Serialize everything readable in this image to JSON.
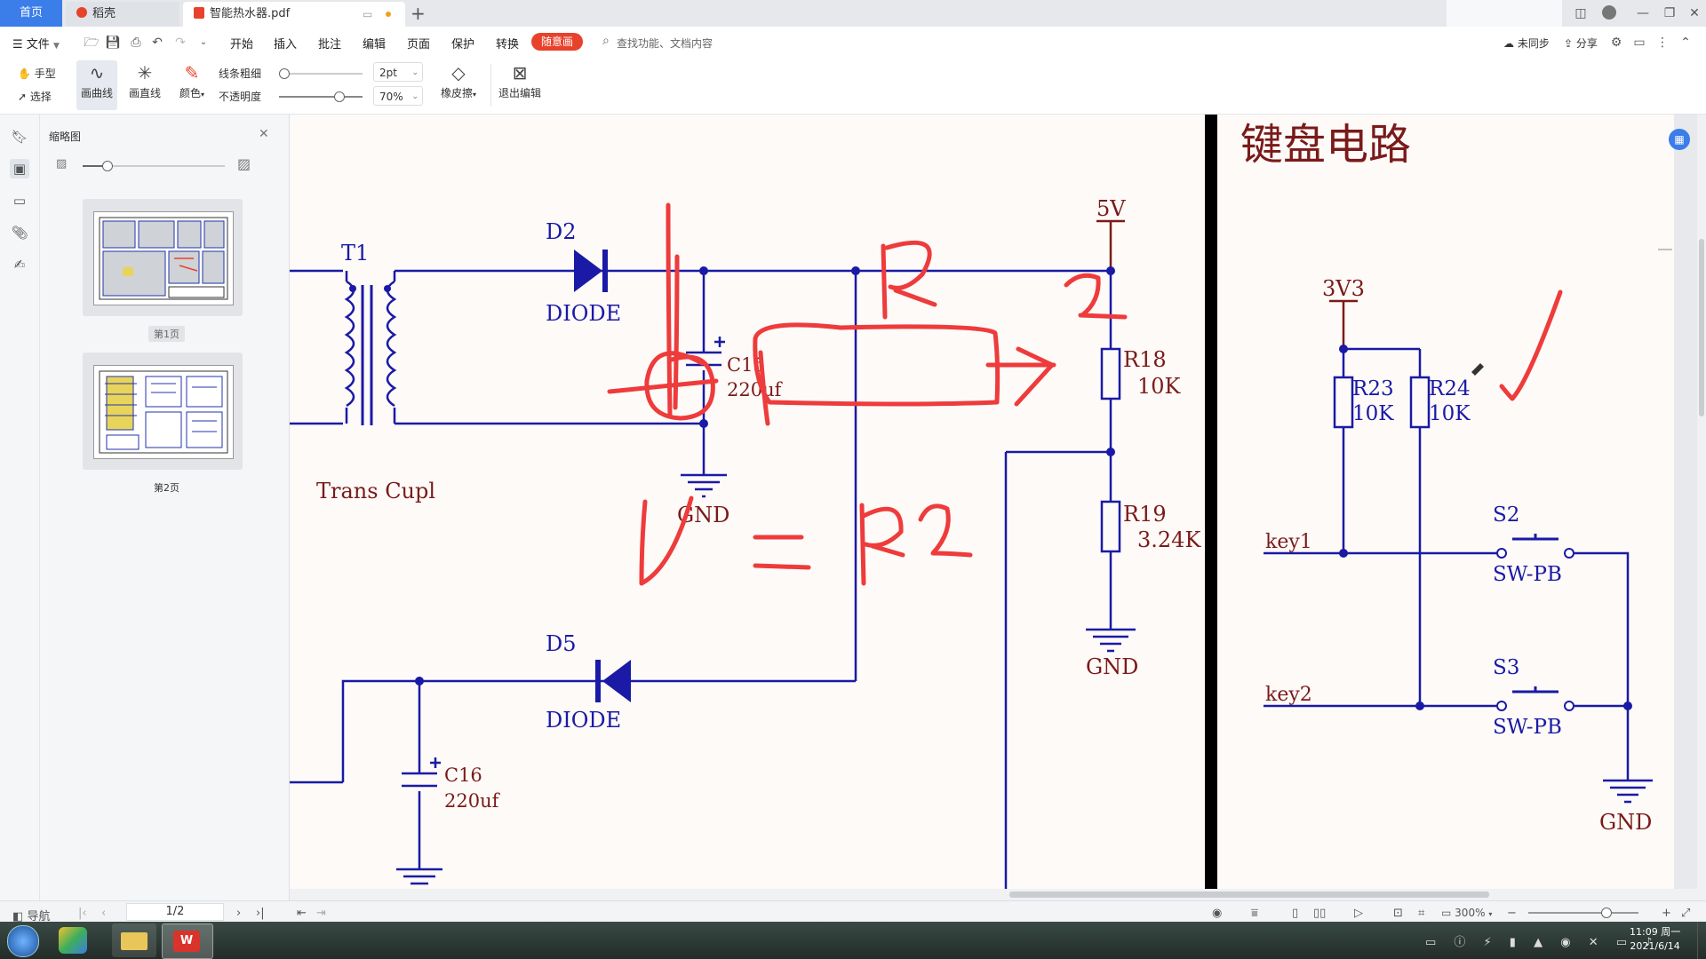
{
  "tabs": {
    "home": "首页",
    "docer": "稻壳",
    "file": "智能热水器.pdf",
    "new_tab": "+"
  },
  "menu": {
    "file": "文件",
    "items": [
      "开始",
      "插入",
      "批注",
      "编辑",
      "页面",
      "保护",
      "转换"
    ],
    "active": "随意画",
    "search_placeholder": "查找功能、文档内容",
    "sync": "未同步",
    "share": "分享"
  },
  "toolbar": {
    "hand": "手型",
    "select": "选择",
    "curve": "画曲线",
    "line": "画直线",
    "color": "颜色",
    "line_width_label": "线条粗细",
    "line_width_value": "2pt",
    "opacity_label": "不透明度",
    "opacity_value": "70%",
    "eraser": "橡皮擦",
    "exit": "退出编辑"
  },
  "panel": {
    "title": "缩略图",
    "pages": [
      {
        "label": "第1页",
        "selected": true
      },
      {
        "label": "第2页",
        "selected": false
      }
    ]
  },
  "schematic": {
    "section_title": "键盘电路",
    "labels": {
      "t1": "T1",
      "d2": "D2",
      "diode1": "DIODE",
      "fivev": "5V",
      "c15": "C15",
      "c15_val": "220uf",
      "r18": "R18",
      "r18_val": "10K",
      "gnd1": "GND",
      "trans": "Trans Cupl",
      "r19": "R19",
      "r19_val": "3.24K",
      "gnd2": "GND",
      "d5": "D5",
      "diode2": "DIODE",
      "c16": "C16",
      "c16_val": "220uf",
      "v3v3": "3V3",
      "r23": "R23",
      "r23_val": "10K",
      "r24": "R24",
      "r24_val": "10K",
      "key1": "key1",
      "key2": "key2",
      "s2": "S2",
      "sw1": "SW-PB",
      "s3": "S3",
      "sw2": "SW-PB",
      "gnd3": "GND"
    },
    "ink_color": "#ee3b3b",
    "wire_color": "#1a1aa6"
  },
  "status": {
    "nav": "导航",
    "page": "1/2",
    "zoom": "300%"
  },
  "taskbar": {
    "time": "11:09 周一",
    "date": "2021/6/14"
  }
}
